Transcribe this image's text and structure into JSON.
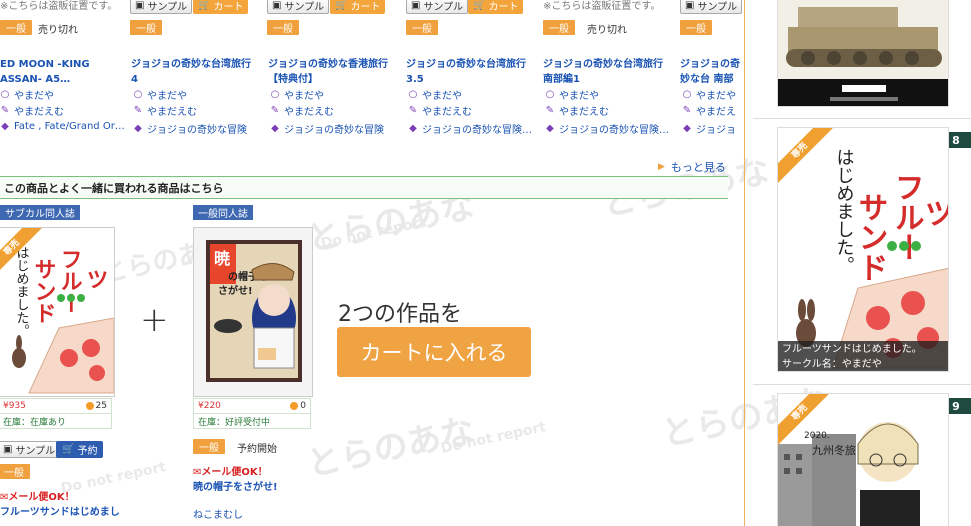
{
  "top_row": {
    "sample_label": "サンプル",
    "cart_label": "カート",
    "general_label": "一般",
    "sold_out_label": "売り切れ",
    "note_partial": "※こちらは盗販征置です。"
  },
  "products": [
    {
      "title": "ED MOON -KING ASSAN- A5…",
      "circle": "やまだや",
      "author": "やまだえむ",
      "genre": "Fate , Fate/Grand Or…"
    },
    {
      "title": "ジョジョの奇妙な台湾旅行 4",
      "circle": "やまだや",
      "author": "やまだえむ",
      "genre": "ジョジョの奇妙な冒険"
    },
    {
      "title": "ジョジョの奇妙な香港旅行【特典付】",
      "circle": "やまだや",
      "author": "やまだえむ",
      "genre": "ジョジョの奇妙な冒険"
    },
    {
      "title": "ジョジョの奇妙な台湾旅行 3.5",
      "circle": "やまだや",
      "author": "やまだえむ",
      "genre": "ジョジョの奇妙な冒険…"
    },
    {
      "title": "ジョジョの奇妙な台湾旅行 南部編1",
      "circle": "やまだや",
      "author": "やまだえむ",
      "genre": "ジョジョの奇妙な冒険…"
    },
    {
      "title": "ジョジョの奇妙な台 南部編2",
      "circle": "やまだや",
      "author": "やまだえ",
      "genre": "ジョジョ"
    }
  ],
  "more_link": "もっと見る",
  "section_title": "この商品とよく一緒に買われる商品はこちら",
  "bundle": {
    "item1": {
      "category": "サブカル同人誌",
      "exclusive": "専売",
      "price": "¥935",
      "points": "25",
      "stock": "在庫：在庫あり",
      "sample_label": "サンプル",
      "reserve_label": "予約",
      "general_label": "一般",
      "mail_ok": "メール便OK！",
      "title": "フルーツサンドはじめまし"
    },
    "item2": {
      "category": "一般同人誌",
      "price": "¥220",
      "points": "0",
      "stock": "在庫：好評受付中",
      "general_label": "一般",
      "status": "予約開始",
      "mail_ok": "メール便OK！",
      "title": "暁の帽子をさがせ!",
      "circle": "ねこまむし"
    },
    "plus": "+",
    "two_works": "2つの作品を",
    "add_to_cart": "カートに入れる"
  },
  "sidebar": {
    "rank8": "8",
    "rank9": "9",
    "exclusive": "専売",
    "caption_title": "フルーツサンドはじめました。",
    "caption_circle": "サークル名：やまだや",
    "book_cover_title": "フルーツサンドはじめました。"
  },
  "watermark": {
    "line1": "とらのあな",
    "line2": "Do not report"
  },
  "colors": {
    "accent": "#f0a342",
    "link": "#1a53b3",
    "blue_tag": "#3f68b3",
    "green_border": "#79c17d",
    "rank_badge": "#1e4a3f"
  }
}
